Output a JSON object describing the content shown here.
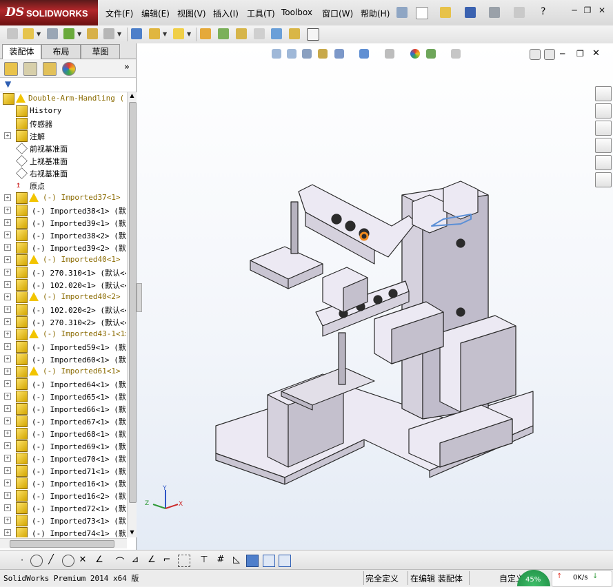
{
  "app": {
    "brand_ds": "DS",
    "brand_name": "SOLIDWORKS"
  },
  "menu": [
    {
      "label": "文件(F)"
    },
    {
      "label": "编辑(E)"
    },
    {
      "label": "视图(V)"
    },
    {
      "label": "插入(I)"
    },
    {
      "label": "工具(T)"
    },
    {
      "label": "Toolbox"
    },
    {
      "label": "窗口(W)"
    },
    {
      "label": "帮助(H)"
    }
  ],
  "help_symbol": "?",
  "tabs": [
    {
      "label": "装配体"
    },
    {
      "label": "布局"
    },
    {
      "label": "草图"
    }
  ],
  "tree": {
    "root": "Double-Arm-Handling  (",
    "items": [
      {
        "text": "History"
      },
      {
        "text": "传感器"
      },
      {
        "text": "注解"
      },
      {
        "text": "前视基准面"
      },
      {
        "text": "上视基准面"
      },
      {
        "text": "右视基准面"
      },
      {
        "text": "原点"
      },
      {
        "text": "(-) Imported37<1> (",
        "warn": true
      },
      {
        "text": "(-) Imported38<1>  (默认"
      },
      {
        "text": "(-) Imported39<1>  (默认"
      },
      {
        "text": "(-) Imported38<2>  (默认"
      },
      {
        "text": "(-) Imported39<2>  (默认"
      },
      {
        "text": "(-) Imported40<1> (",
        "warn": true
      },
      {
        "text": "(-) 270.310<1>  (默认<<"
      },
      {
        "text": "(-) 102.020<1>  (默认<<"
      },
      {
        "text": "(-) Imported40<2> (",
        "warn": true
      },
      {
        "text": "(-) 102.020<2>  (默认<<"
      },
      {
        "text": "(-) 270.310<2>  (默认<<"
      },
      {
        "text": "(-) Imported43-1<1>",
        "warn": true
      },
      {
        "text": "(-) Imported59<1>  (默认"
      },
      {
        "text": "(-) Imported60<1>  (默认"
      },
      {
        "text": "(-) Imported61<1> (",
        "warn": true
      },
      {
        "text": "(-) Imported64<1>  (默认"
      },
      {
        "text": "(-) Imported65<1>  (默认"
      },
      {
        "text": "(-) Imported66<1>  (默认"
      },
      {
        "text": "(-) Imported67<1>  (默认"
      },
      {
        "text": "(-) Imported68<1>  (默认"
      },
      {
        "text": "(-) Imported69<1>  (默认"
      },
      {
        "text": "(-) Imported70<1>  (默认"
      },
      {
        "text": "(-) Imported71<1>  (默认"
      },
      {
        "text": "(-) Imported16<1>  (默认"
      },
      {
        "text": "(-) Imported16<2>  (默认"
      },
      {
        "text": "(-) Imported72<1>  (默认"
      },
      {
        "text": "(-) Imported73<1>  (默认"
      },
      {
        "text": "(-) Imported74<1>  (默认"
      }
    ]
  },
  "triad": {
    "x": "X",
    "y": "Y",
    "z": "Z"
  },
  "status": {
    "product": "SolidWorks Premium 2014 x64 版",
    "constraint": "完全定义",
    "mode": "在编辑 装配体",
    "custom": "自定义",
    "net_speed": "0K/s",
    "net_percent": "45%"
  },
  "colors": {
    "brand_red": "#b2272a",
    "tree_warn_text": "#8a6a00",
    "part_face": "#ece9f3",
    "viewport_bottom": "#e4ebf5"
  }
}
